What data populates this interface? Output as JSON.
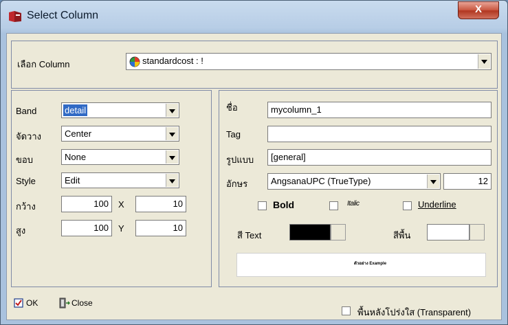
{
  "window": {
    "title": "Select Column",
    "close_glyph": "X"
  },
  "column_select": {
    "label": "เลือก Column",
    "value": "standardcost : !",
    "icon": "color-ball-icon"
  },
  "left_panel": {
    "band": {
      "label": "Band",
      "value": "detail"
    },
    "align": {
      "label": "จัดวาง",
      "value": "Center"
    },
    "border": {
      "label": "ขอบ",
      "value": "None"
    },
    "style": {
      "label": "Style",
      "value": "Edit"
    },
    "width": {
      "label": "กว้าง",
      "value": "100"
    },
    "x": {
      "label": "X",
      "value": "10"
    },
    "height": {
      "label": "สูง",
      "value": "100"
    },
    "y": {
      "label": "Y",
      "value": "10"
    }
  },
  "right_panel": {
    "name": {
      "label": "ชื่อ",
      "value": "mycolumn_1"
    },
    "tag": {
      "label": "Tag",
      "value": ""
    },
    "format": {
      "label": "รูปแบบ",
      "value": "[general]"
    },
    "font": {
      "label": "อักษร",
      "value": "AngsanaUPC (TrueType)",
      "size": "12"
    },
    "bold": {
      "label": "Bold",
      "checked": false
    },
    "italic": {
      "label": "Italic",
      "checked": false
    },
    "underline": {
      "label": "Underline",
      "checked": false
    },
    "text_color": {
      "label": "สี Text",
      "color": "#000000"
    },
    "bg_color": {
      "label": "สีพื้น",
      "color": "#ffffff"
    },
    "preview_text": "ตัวอย่าง Example"
  },
  "footer": {
    "ok_label": "OK",
    "close_label": "Close",
    "transparent_label": "พื้นหลังโปร่งใส (Transparent)",
    "transparent_checked": false
  }
}
